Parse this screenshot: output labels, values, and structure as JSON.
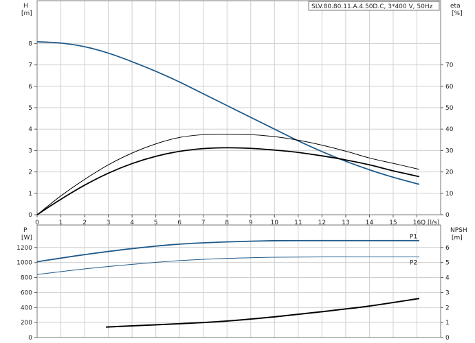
{
  "chart_data": [
    {
      "type": "line",
      "title": "SLV.80.80.11.A.4.50D.C, 3*400 V, 50Hz",
      "xlabel": "Q [l/s]",
      "xlim": [
        0,
        17
      ],
      "x_ticks": [
        "0",
        "1",
        "2",
        "3",
        "4",
        "5",
        "6",
        "7",
        "8",
        "9",
        "10",
        "11",
        "12",
        "13",
        "14",
        "15",
        "16"
      ],
      "ylabel_left": [
        "H",
        "[m]"
      ],
      "ylim_left": [
        0,
        10
      ],
      "y_ticks_left": [
        "0",
        "1",
        "2",
        "3",
        "4",
        "5",
        "6",
        "7",
        "8"
      ],
      "ylabel_right": [
        "eta",
        "[%]"
      ],
      "ylim_right": [
        0,
        100
      ],
      "y_ticks_right": [
        "0",
        "10",
        "20",
        "30",
        "40",
        "50",
        "60",
        "70"
      ],
      "grid": true,
      "series": [
        {
          "axis": "left",
          "color": "#1f5a8a",
          "x": [
            0,
            1,
            2,
            3,
            4,
            5,
            6,
            7,
            8,
            9,
            10,
            11,
            12,
            13,
            14,
            15,
            16.1
          ],
          "values": [
            8.08,
            8.02,
            7.85,
            7.55,
            7.15,
            6.7,
            6.2,
            5.65,
            5.1,
            4.55,
            4.0,
            3.45,
            2.95,
            2.5,
            2.1,
            1.75,
            1.42
          ]
        },
        {
          "axis": "right",
          "color": "#000000",
          "x": [
            0,
            1,
            2,
            3,
            4,
            5,
            6,
            7,
            8,
            9,
            10,
            11,
            12,
            13,
            14,
            15,
            16.1
          ],
          "values": [
            0,
            8.8,
            16.5,
            23.3,
            28.8,
            33.1,
            36.1,
            37.4,
            37.6,
            37.4,
            36.5,
            34.8,
            32.5,
            29.7,
            26.5,
            24,
            21.2
          ]
        },
        {
          "axis": "right",
          "color": "#000000",
          "x": [
            0,
            1,
            2,
            3,
            4,
            5,
            6,
            7,
            8,
            9,
            10,
            11,
            12,
            13,
            14,
            15,
            16.1
          ],
          "values": [
            0,
            7.2,
            13.8,
            19.4,
            23.9,
            27.3,
            29.6,
            30.9,
            31.3,
            31.0,
            30.2,
            29.1,
            27.5,
            25.6,
            23.3,
            20.5,
            17.8
          ]
        }
      ]
    },
    {
      "type": "line",
      "xlim": [
        0,
        17
      ],
      "ylabel_left": [
        "P",
        "[W]"
      ],
      "ylim_left": [
        0,
        1500
      ],
      "y_ticks_left": [
        "0",
        "200",
        "400",
        "600",
        "800",
        "1000",
        "1200"
      ],
      "ylabel_right": [
        "NPSH",
        "[m]"
      ],
      "ylim_right": [
        0,
        7.5
      ],
      "y_ticks_right": [
        "0",
        "1",
        "2",
        "3",
        "4",
        "5",
        "6"
      ],
      "grid": true,
      "series": [
        {
          "name": "P1",
          "axis": "left",
          "color": "#1f5a8a",
          "x": [
            0,
            2,
            4,
            6,
            8,
            10,
            12,
            14,
            16.1
          ],
          "values": [
            1010,
            1105,
            1185,
            1245,
            1275,
            1290,
            1292,
            1292,
            1292
          ]
        },
        {
          "name": "P2",
          "axis": "left",
          "color": "#1f5a8a",
          "x": [
            0,
            2,
            4,
            6,
            8,
            10,
            12,
            14,
            16.1
          ],
          "values": [
            840,
            915,
            975,
            1025,
            1055,
            1070,
            1075,
            1075,
            1075
          ]
        },
        {
          "axis": "right",
          "color": "#000000",
          "x": [
            2.9,
            4,
            6,
            8,
            10,
            12,
            14,
            16.1
          ],
          "values": [
            0.7,
            0.78,
            0.92,
            1.1,
            1.38,
            1.72,
            2.1,
            2.6
          ]
        }
      ]
    }
  ]
}
